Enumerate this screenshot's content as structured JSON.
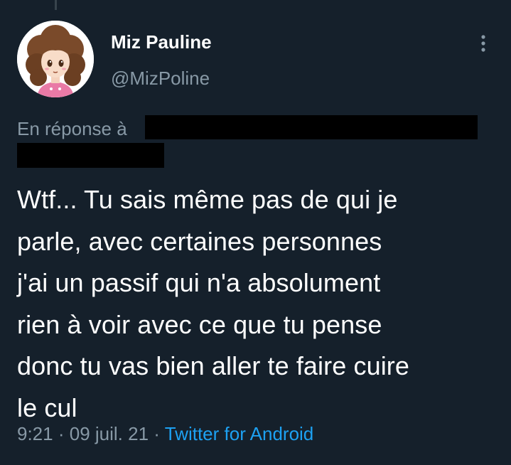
{
  "tweet": {
    "author_name": "Miz Pauline",
    "author_handle": "@MizPoline",
    "reply_label": "En réponse à",
    "text": "Wtf... Tu sais même pas de qui je\nparle, avec certaines personnes\nj'ai un passif qui n'a absolument\nrien à voir avec ce que tu pense\ndonc tu vas bien aller te faire cuire\nle cul",
    "time": "9:21",
    "separator": "·",
    "date": "09 juil. 21",
    "source": "Twitter for Android"
  },
  "icons": {
    "more": "more-vertical-icon"
  },
  "colors": {
    "background": "#15202b",
    "text_primary": "#ffffff",
    "text_secondary": "#8899a6",
    "link": "#1da1f2"
  }
}
